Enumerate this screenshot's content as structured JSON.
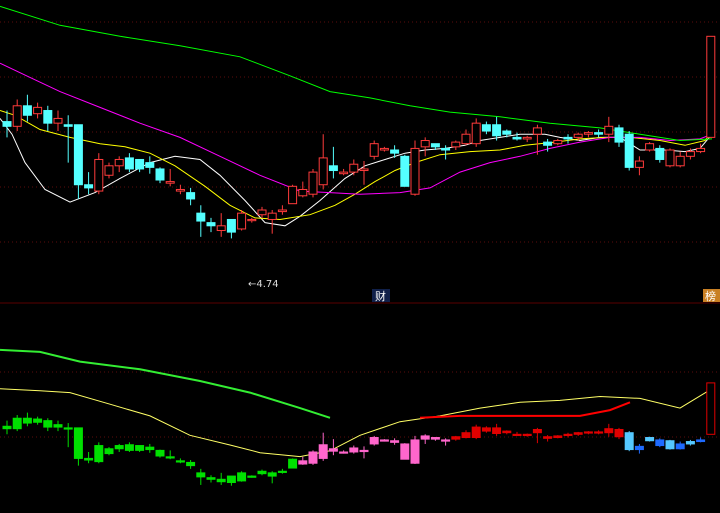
{
  "chart_data": [
    {
      "type": "candlestick",
      "panel": "main",
      "ylim": [
        4.35,
        6.25
      ],
      "grid": true,
      "up_color": "#ff3b3b",
      "down_color": "#54ffff",
      "ma_colors": {
        "ma5": "#ffffff",
        "ma10": "#ffff00",
        "ma20": "#ff00ff",
        "ma60": "#00ff00"
      },
      "candles": [
        [
          5.48,
          5.55,
          5.38,
          5.45
        ],
        [
          5.45,
          5.62,
          5.42,
          5.58
        ],
        [
          5.58,
          5.65,
          5.48,
          5.52
        ],
        [
          5.53,
          5.6,
          5.5,
          5.57
        ],
        [
          5.55,
          5.58,
          5.42,
          5.47
        ],
        [
          5.47,
          5.55,
          5.42,
          5.5
        ],
        [
          5.46,
          5.52,
          5.22,
          5.45
        ],
        [
          5.46,
          5.46,
          4.99,
          5.08
        ],
        [
          5.08,
          5.16,
          5.02,
          5.06
        ],
        [
          5.04,
          5.28,
          5.02,
          5.24
        ],
        [
          5.14,
          5.22,
          5.12,
          5.2
        ],
        [
          5.2,
          5.26,
          5.16,
          5.24
        ],
        [
          5.25,
          5.28,
          5.16,
          5.18
        ],
        [
          5.24,
          5.24,
          5.16,
          5.18
        ],
        [
          5.22,
          5.26,
          5.15,
          5.19
        ],
        [
          5.18,
          5.19,
          5.09,
          5.11
        ],
        [
          5.09,
          5.18,
          5.07,
          5.1
        ],
        [
          5.04,
          5.08,
          5.02,
          5.05
        ],
        [
          5.03,
          5.06,
          4.95,
          4.99
        ],
        [
          4.9,
          4.95,
          4.75,
          4.85
        ],
        [
          4.84,
          4.87,
          4.78,
          4.82
        ],
        [
          4.79,
          4.9,
          4.75,
          4.82
        ],
        [
          4.86,
          4.86,
          4.74,
          4.78
        ],
        [
          4.8,
          4.92,
          4.79,
          4.9
        ],
        [
          4.86,
          4.87,
          4.84,
          4.86
        ],
        [
          4.89,
          4.94,
          4.87,
          4.92
        ],
        [
          4.86,
          4.92,
          4.77,
          4.9
        ],
        [
          4.91,
          4.95,
          4.89,
          4.92
        ],
        [
          4.96,
          5.08,
          4.96,
          5.07
        ],
        [
          5.01,
          5.1,
          5.0,
          5.05
        ],
        [
          5.02,
          5.18,
          5.0,
          5.16
        ],
        [
          5.08,
          5.4,
          5.05,
          5.25
        ],
        [
          5.2,
          5.32,
          5.12,
          5.17
        ],
        [
          5.15,
          5.18,
          5.14,
          5.16
        ],
        [
          5.16,
          5.24,
          5.14,
          5.21
        ],
        [
          5.17,
          5.23,
          5.08,
          5.18
        ],
        [
          5.26,
          5.36,
          5.24,
          5.34
        ],
        [
          5.3,
          5.32,
          5.29,
          5.31
        ],
        [
          5.3,
          5.33,
          5.25,
          5.28
        ],
        [
          5.26,
          5.27,
          5.12,
          5.07
        ],
        [
          5.02,
          5.36,
          5.01,
          5.31
        ],
        [
          5.32,
          5.38,
          5.26,
          5.36
        ],
        [
          5.34,
          5.34,
          5.3,
          5.32
        ],
        [
          5.31,
          5.33,
          5.24,
          5.3
        ],
        [
          5.32,
          5.36,
          5.3,
          5.35
        ],
        [
          5.34,
          5.43,
          5.33,
          5.4
        ],
        [
          5.34,
          5.5,
          5.32,
          5.47
        ],
        [
          5.46,
          5.48,
          5.4,
          5.42
        ],
        [
          5.46,
          5.51,
          5.36,
          5.39
        ],
        [
          5.42,
          5.43,
          5.38,
          5.4
        ],
        [
          5.38,
          5.41,
          5.36,
          5.37
        ],
        [
          5.37,
          5.39,
          5.35,
          5.38
        ],
        [
          5.4,
          5.46,
          5.27,
          5.44
        ],
        [
          5.35,
          5.37,
          5.29,
          5.33
        ],
        [
          5.34,
          5.37,
          5.33,
          5.36
        ],
        [
          5.38,
          5.4,
          5.34,
          5.37
        ],
        [
          5.38,
          5.41,
          5.36,
          5.4
        ],
        [
          5.4,
          5.42,
          5.38,
          5.41
        ],
        [
          5.41,
          5.43,
          5.38,
          5.4
        ],
        [
          5.4,
          5.51,
          5.35,
          5.45
        ],
        [
          5.44,
          5.46,
          5.32,
          5.35
        ],
        [
          5.4,
          5.42,
          5.17,
          5.19
        ],
        [
          5.19,
          5.26,
          5.14,
          5.23
        ],
        [
          5.3,
          5.35,
          5.29,
          5.34
        ],
        [
          5.31,
          5.33,
          5.22,
          5.24
        ],
        [
          5.2,
          5.31,
          5.19,
          5.3
        ],
        [
          5.2,
          5.29,
          5.19,
          5.26
        ],
        [
          5.26,
          5.31,
          5.24,
          5.29
        ],
        [
          5.29,
          5.34,
          5.28,
          5.31
        ],
        [
          5.38,
          6.02,
          5.38,
          6.02
        ]
      ],
      "moving_averages": {
        "ma5": [
          [
            0,
            5.5
          ],
          [
            12,
            5.4
          ],
          [
            25,
            5.22
          ],
          [
            45,
            5.05
          ],
          [
            70,
            4.97
          ],
          [
            95,
            5.03
          ],
          [
            120,
            5.12
          ],
          [
            150,
            5.22
          ],
          [
            175,
            5.26
          ],
          [
            200,
            5.24
          ],
          [
            220,
            5.14
          ],
          [
            245,
            4.98
          ],
          [
            265,
            4.84
          ],
          [
            285,
            4.82
          ],
          [
            300,
            4.88
          ],
          [
            320,
            4.98
          ],
          [
            345,
            5.12
          ],
          [
            365,
            5.2
          ],
          [
            385,
            5.24
          ],
          [
            405,
            5.28
          ],
          [
            425,
            5.3
          ],
          [
            445,
            5.31
          ],
          [
            465,
            5.33
          ],
          [
            480,
            5.36
          ],
          [
            500,
            5.38
          ],
          [
            520,
            5.4
          ],
          [
            545,
            5.4
          ],
          [
            560,
            5.38
          ],
          [
            580,
            5.36
          ],
          [
            600,
            5.38
          ],
          [
            620,
            5.38
          ],
          [
            640,
            5.3
          ],
          [
            665,
            5.3
          ],
          [
            685,
            5.29
          ],
          [
            700,
            5.31
          ],
          [
            712,
            5.4
          ]
        ],
        "ma10": [
          [
            0,
            5.55
          ],
          [
            15,
            5.52
          ],
          [
            40,
            5.43
          ],
          [
            70,
            5.38
          ],
          [
            100,
            5.34
          ],
          [
            125,
            5.32
          ],
          [
            150,
            5.28
          ],
          [
            175,
            5.2
          ],
          [
            205,
            5.07
          ],
          [
            230,
            4.95
          ],
          [
            255,
            4.87
          ],
          [
            280,
            4.86
          ],
          [
            310,
            4.89
          ],
          [
            335,
            4.95
          ],
          [
            355,
            5.02
          ],
          [
            375,
            5.1
          ],
          [
            395,
            5.17
          ],
          [
            415,
            5.22
          ],
          [
            440,
            5.27
          ],
          [
            470,
            5.29
          ],
          [
            500,
            5.3
          ],
          [
            525,
            5.33
          ],
          [
            555,
            5.35
          ],
          [
            580,
            5.37
          ],
          [
            605,
            5.38
          ],
          [
            630,
            5.38
          ],
          [
            660,
            5.36
          ],
          [
            685,
            5.33
          ],
          [
            705,
            5.36
          ],
          [
            712,
            5.42
          ]
        ],
        "ma20": [
          [
            0,
            5.85
          ],
          [
            30,
            5.76
          ],
          [
            60,
            5.67
          ],
          [
            100,
            5.57
          ],
          [
            140,
            5.47
          ],
          [
            180,
            5.38
          ],
          [
            220,
            5.26
          ],
          [
            260,
            5.14
          ],
          [
            300,
            5.04
          ],
          [
            330,
            5.03
          ],
          [
            360,
            5.02
          ],
          [
            400,
            5.03
          ],
          [
            430,
            5.06
          ],
          [
            460,
            5.16
          ],
          [
            490,
            5.22
          ],
          [
            520,
            5.26
          ],
          [
            550,
            5.31
          ],
          [
            580,
            5.35
          ],
          [
            610,
            5.38
          ],
          [
            640,
            5.38
          ],
          [
            670,
            5.36
          ],
          [
            700,
            5.37
          ],
          [
            712,
            5.4
          ]
        ],
        "ma60": [
          [
            0,
            6.21
          ],
          [
            60,
            6.09
          ],
          [
            120,
            6.02
          ],
          [
            180,
            5.96
          ],
          [
            240,
            5.89
          ],
          [
            290,
            5.77
          ],
          [
            330,
            5.67
          ],
          [
            370,
            5.63
          ],
          [
            410,
            5.58
          ],
          [
            450,
            5.54
          ],
          [
            500,
            5.51
          ],
          [
            550,
            5.47
          ],
          [
            600,
            5.44
          ],
          [
            640,
            5.4
          ],
          [
            680,
            5.36
          ],
          [
            712,
            5.37
          ]
        ]
      },
      "annotation_low": {
        "text": "←4.74",
        "value": 4.74,
        "index": 22
      }
    },
    {
      "type": "candlestick",
      "panel": "indicator",
      "ylim": [
        0,
        1
      ],
      "grid": true,
      "colors": {
        "green": "#00e000",
        "pink": "#ff66cc",
        "red": "#e00000",
        "blue": "#1e6bff",
        "light_blue": "#55c8ff",
        "upper_line": "#33ee33",
        "lower_line": "#ffff66",
        "lower_line_2": "#ff0000"
      },
      "upper_line": [
        [
          0,
          0.82
        ],
        [
          40,
          0.81
        ],
        [
          80,
          0.76
        ],
        [
          140,
          0.72
        ],
        [
          200,
          0.66
        ],
        [
          250,
          0.6
        ],
        [
          300,
          0.52
        ],
        [
          330,
          0.47
        ]
      ],
      "lower_line": [
        [
          0,
          0.62
        ],
        [
          40,
          0.61
        ],
        [
          70,
          0.6
        ],
        [
          110,
          0.54
        ],
        [
          150,
          0.48
        ],
        [
          190,
          0.38
        ],
        [
          230,
          0.33
        ],
        [
          260,
          0.29
        ],
        [
          300,
          0.27
        ],
        [
          330,
          0.3
        ],
        [
          360,
          0.38
        ],
        [
          400,
          0.45
        ],
        [
          440,
          0.48
        ],
        [
          480,
          0.52
        ],
        [
          520,
          0.55
        ],
        [
          560,
          0.56
        ],
        [
          600,
          0.58
        ],
        [
          640,
          0.57
        ],
        [
          680,
          0.52
        ],
        [
          712,
          0.62
        ]
      ],
      "lower_line_2": [
        [
          420,
          0.47
        ],
        [
          460,
          0.48
        ],
        [
          500,
          0.48
        ],
        [
          540,
          0.48
        ],
        [
          580,
          0.48
        ],
        [
          610,
          0.51
        ],
        [
          630,
          0.55
        ]
      ]
    }
  ],
  "labels": {
    "low_marker": "←4.74",
    "marker_cai": "财",
    "marker_bang": "榜"
  }
}
